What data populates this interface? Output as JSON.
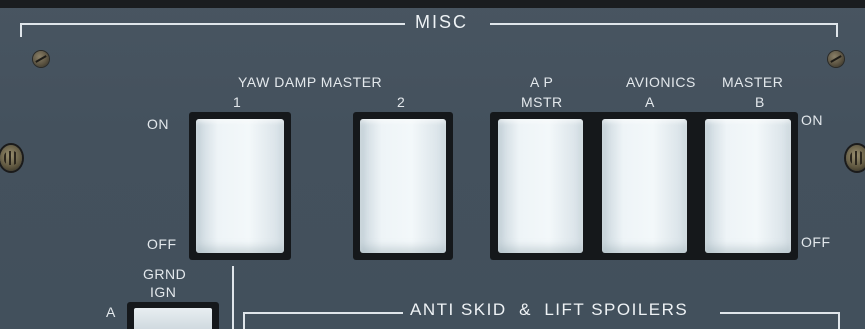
{
  "misc": {
    "title": "MISC",
    "yaw_damp_label": "YAW DAMP MASTER",
    "yaw_damp_1": "1",
    "yaw_damp_2": "2",
    "ap_label_1": "A P",
    "ap_label_2": "MSTR",
    "avionics_label": "AVIONICS",
    "avionics_a": "A",
    "master_label": "MASTER",
    "master_b": "B",
    "on_left": "ON",
    "off_left": "OFF",
    "on_right": "ON",
    "off_right": "OFF"
  },
  "lower": {
    "grnd_ign_1": "GRND",
    "grnd_ign_2": "IGN",
    "a_label": "A",
    "anti_skid_title": "ANTI SKID  &  LIFT SPOILERS"
  },
  "colors": {
    "panel": "#44515d",
    "legend": "#e3e8ec",
    "switch_face": "#eef4f7"
  }
}
